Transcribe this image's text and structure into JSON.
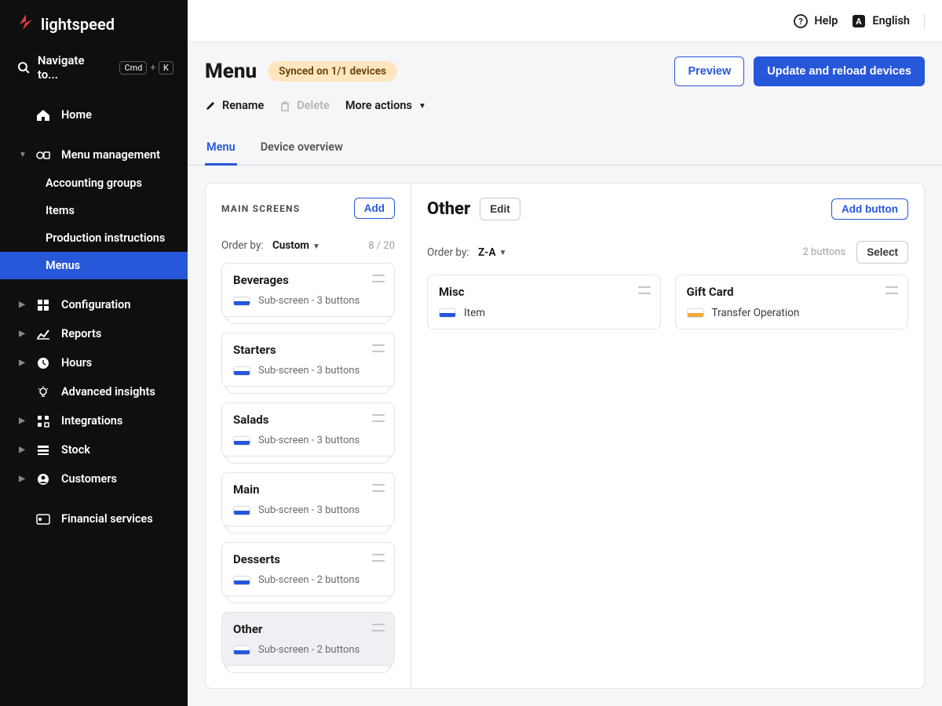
{
  "brand": {
    "name": "lightspeed"
  },
  "search": {
    "placeholder": "Navigate to...",
    "kbd1": "Cmd",
    "kbd2": "K"
  },
  "sidebar": {
    "home": "Home",
    "menu_mgmt": "Menu management",
    "menu_mgmt_children": [
      {
        "label": "Accounting groups"
      },
      {
        "label": "Items"
      },
      {
        "label": "Production instructions"
      },
      {
        "label": "Menus",
        "active": true
      }
    ],
    "configuration": "Configuration",
    "reports": "Reports",
    "hours": "Hours",
    "advanced": "Advanced insights",
    "integrations": "Integrations",
    "stock": "Stock",
    "customers": "Customers",
    "financial": "Financial services"
  },
  "topbar": {
    "help": "Help",
    "lang": "English"
  },
  "header": {
    "title": "Menu",
    "sync_badge": "Synced on 1/1 devices",
    "preview": "Preview",
    "update": "Update and reload devices",
    "rename": "Rename",
    "delete": "Delete",
    "more": "More actions"
  },
  "tabs": {
    "menu": "Menu",
    "device": "Device overview"
  },
  "left": {
    "heading": "MAIN SCREENS",
    "add": "Add",
    "order_label": "Order by:",
    "order_value": "Custom",
    "count": "8 / 20",
    "cards": [
      {
        "title": "Beverages",
        "sub": "Sub-screen - 3 buttons",
        "color": "#2757d9"
      },
      {
        "title": "Starters",
        "sub": "Sub-screen - 3 buttons",
        "color": "#2757d9"
      },
      {
        "title": "Salads",
        "sub": "Sub-screen - 3 buttons",
        "color": "#2757d9"
      },
      {
        "title": "Main",
        "sub": "Sub-screen - 3 buttons",
        "color": "#2757d9"
      },
      {
        "title": "Desserts",
        "sub": "Sub-screen - 2 buttons",
        "color": "#2757d9"
      },
      {
        "title": "Other",
        "sub": "Sub-screen - 2 buttons",
        "color": "#2757d9",
        "selected": true
      }
    ]
  },
  "right": {
    "heading": "Other",
    "edit": "Edit",
    "add_button": "Add button",
    "order_label": "Order by:",
    "order_value": "Z-A",
    "count": "2 buttons",
    "select": "Select",
    "cards": [
      {
        "title": "Misc",
        "sub": "Item",
        "color": "#2757d9"
      },
      {
        "title": "Gift Card",
        "sub": "Transfer Operation",
        "color": "#f2a93b"
      }
    ]
  }
}
